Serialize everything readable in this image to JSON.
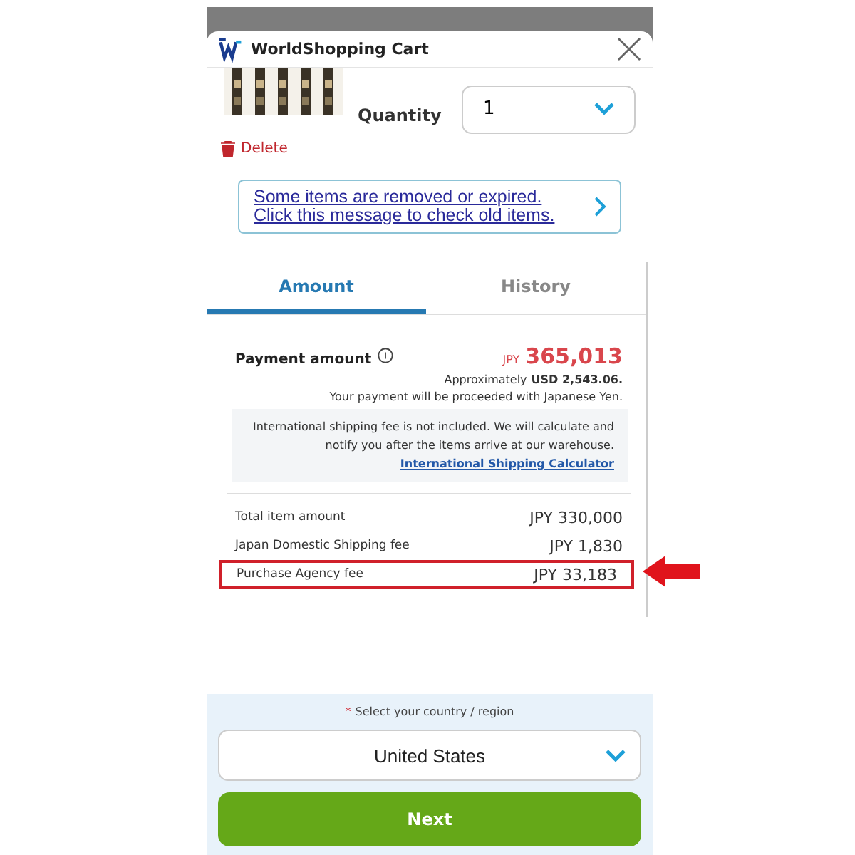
{
  "header": {
    "title": "WorldShopping Cart"
  },
  "item": {
    "quantity_label": "Quantity",
    "quantity": "1",
    "delete": "Delete"
  },
  "notice": {
    "text": "Some items are removed or expired. Click this message to check old items."
  },
  "tabs": [
    {
      "label": "Amount",
      "selected": true
    },
    {
      "label": "History",
      "selected": false
    }
  ],
  "payment": {
    "label": "Payment amount",
    "currency": "JPY",
    "amount": "365,013",
    "approx_prefix": "Approximately",
    "approx_value": "USD 2,543.06.",
    "note": "Your payment will be proceeded with Japanese Yen."
  },
  "shipping_note": {
    "text": "International shipping fee is not included. We will calculate and notify you after the items arrive at our warehouse.",
    "link": "International Shipping Calculator"
  },
  "breakdown": [
    {
      "label": "Total item amount",
      "value": "JPY 330,000",
      "highlighted": false
    },
    {
      "label": "Japan Domestic Shipping fee",
      "value": "JPY 1,830",
      "highlighted": false
    },
    {
      "label": "Purchase Agency fee",
      "value": "JPY 33,183",
      "highlighted": true
    }
  ],
  "country": {
    "required_mark": "*",
    "label": "Select your country / region",
    "value": "United States"
  },
  "next_button": "Next"
}
